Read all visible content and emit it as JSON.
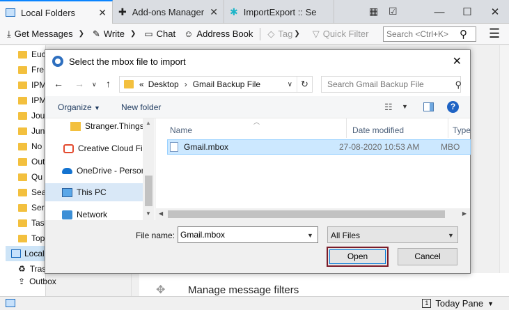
{
  "app": {
    "tabs": [
      {
        "label": "Local Folders"
      },
      {
        "label": "Add-ons Manager"
      },
      {
        "label": "ImportExport :: Se"
      }
    ],
    "window_controls": {
      "minimize": "—",
      "maximize": "☐",
      "close": "✕"
    }
  },
  "toolbar": {
    "get_messages": "Get Messages",
    "write": "Write",
    "chat": "Chat",
    "address_book": "Address Book",
    "tag": "Tag",
    "quick_filter": "Quick Filter",
    "search_placeholder": "Search <Ctrl+K>"
  },
  "folders": {
    "items": [
      "Euc",
      "Fre",
      "IPM",
      "IPM",
      "Jou",
      "Jun",
      "No",
      "Out",
      "Qu",
      "Sea",
      "Ser",
      "Tas",
      "Top"
    ],
    "root_label": "Local",
    "trash": "Tras",
    "outbox": "Outbox"
  },
  "main": {
    "manage_filters": "Manage message filters"
  },
  "status": {
    "today_pane": "Today Pane",
    "today_pane_day": "1"
  },
  "dialog": {
    "title": "Select the mbox file to import",
    "breadcrumb_prefix": "«",
    "breadcrumb": [
      "Desktop",
      "Gmail Backup File"
    ],
    "search_placeholder": "Search Gmail Backup File",
    "organize": "Organize",
    "new_folder": "New folder",
    "nav_items": [
      {
        "label": "Stranger.Things.",
        "icon": "folder"
      },
      {
        "label": "Creative Cloud Fil",
        "icon": "creative-cloud"
      },
      {
        "label": "OneDrive - Person",
        "icon": "onedrive"
      },
      {
        "label": "This PC",
        "icon": "pc"
      },
      {
        "label": "Network",
        "icon": "network"
      }
    ],
    "columns": {
      "name": "Name",
      "date": "Date modified",
      "type": "Type"
    },
    "files": [
      {
        "name": "Gmail.mbox",
        "date": "27-08-2020 10:53 AM",
        "type": "MBO"
      }
    ],
    "file_name_label": "File name:",
    "file_name_value": "Gmail.mbox",
    "file_type": "All Files",
    "open": "Open",
    "cancel": "Cancel"
  },
  "colors": {
    "accent": "#0a84ff",
    "selection": "#cce8ff",
    "open_border": "#7a1c2a",
    "folder": "#f3c03e"
  }
}
